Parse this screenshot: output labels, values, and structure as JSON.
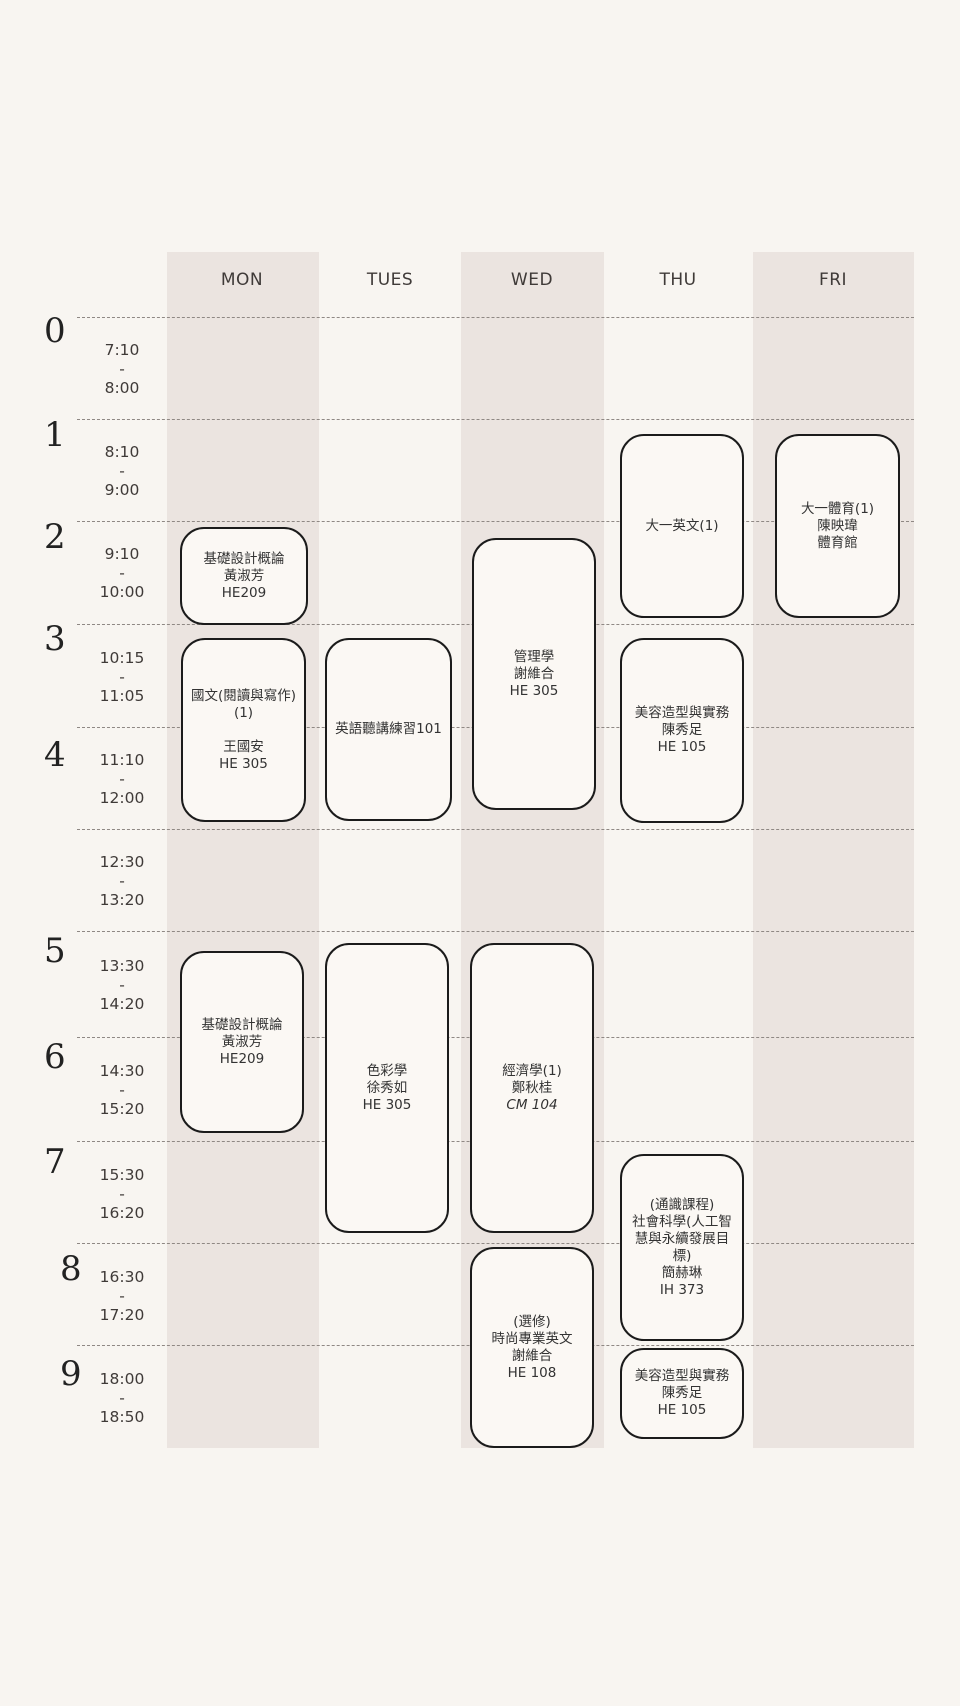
{
  "days": [
    "MON",
    "TUES",
    "WED",
    "THU",
    "FRI"
  ],
  "periods": [
    {
      "num": "0",
      "start": "7:10",
      "sep": "-",
      "end": "8:00"
    },
    {
      "num": "1",
      "start": "8:10",
      "sep": "-",
      "end": "9:00"
    },
    {
      "num": "2",
      "start": "9:10",
      "sep": "-",
      "end": "10:00"
    },
    {
      "num": "3",
      "start": "10:15",
      "sep": "-",
      "end": "11:05"
    },
    {
      "num": "4",
      "start": "11:10",
      "sep": "-",
      "end": "12:00"
    },
    {
      "num": "",
      "start": "12:30",
      "sep": "-",
      "end": "13:20"
    },
    {
      "num": "5",
      "start": "13:30",
      "sep": "-",
      "end": "14:20"
    },
    {
      "num": "6",
      "start": "14:30",
      "sep": "-",
      "end": "15:20"
    },
    {
      "num": "7",
      "start": "15:30",
      "sep": "-",
      "end": "16:20"
    },
    {
      "num": "8",
      "start": "16:30",
      "sep": "-",
      "end": "17:20"
    },
    {
      "num": "9",
      "start": "18:00",
      "sep": "-",
      "end": "18:50"
    }
  ],
  "courses": {
    "mon_design_am": {
      "lines": [
        "基礎設計概論",
        "黃淑芳",
        "HE209"
      ]
    },
    "mon_chinese": {
      "lines": [
        "國文(閱讀與寫作)",
        "(1)",
        "",
        "王國安",
        "HE 305"
      ]
    },
    "mon_design_pm": {
      "lines": [
        "基礎設計概論",
        "黃淑芳",
        "HE209"
      ]
    },
    "tue_listening": {
      "lines": [
        "英語聽講練習101"
      ]
    },
    "tue_color": {
      "lines": [
        "色彩學",
        "徐秀如",
        "HE 305"
      ]
    },
    "wed_management": {
      "lines": [
        "管理學",
        "謝維合",
        "HE 305"
      ]
    },
    "wed_economics": {
      "lines": [
        "經濟學(1)",
        "鄭秋桂",
        "CM 104"
      ]
    },
    "wed_fashion_english": {
      "lines": [
        "(選修)",
        "時尚專業英文",
        "謝維合",
        "HE 108"
      ]
    },
    "thu_english": {
      "lines": [
        "大一英文(1)"
      ]
    },
    "thu_beauty_am": {
      "lines": [
        "美容造型與實務",
        "陳秀足",
        "HE 105"
      ]
    },
    "thu_social": {
      "lines": [
        "(通識課程)",
        "社會科學(人工智",
        "慧與永續發展目",
        "標)",
        "簡赫琳",
        "IH 373"
      ]
    },
    "thu_beauty_pm": {
      "lines": [
        "美容造型與實務",
        "陳秀足",
        "HE 105"
      ]
    },
    "fri_pe": {
      "lines": [
        "大一體育(1)",
        "陳映瑋",
        "體育館"
      ]
    }
  }
}
